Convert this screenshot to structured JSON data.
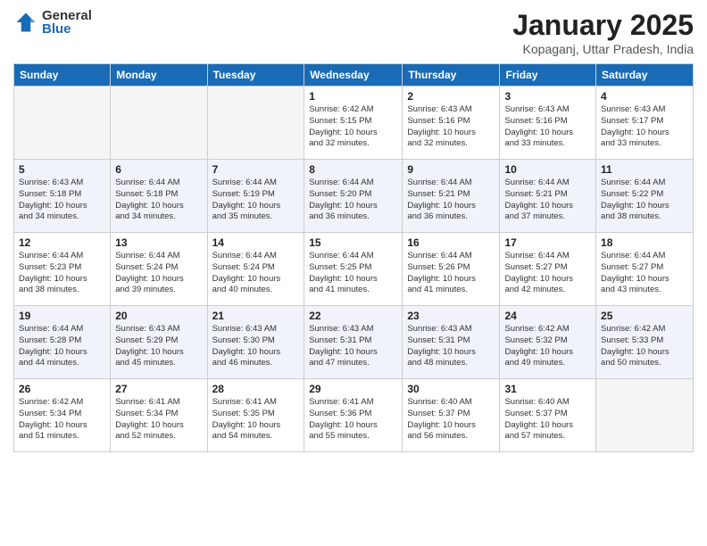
{
  "logo": {
    "general": "General",
    "blue": "Blue"
  },
  "title": {
    "month": "January 2025",
    "location": "Kopaganj, Uttar Pradesh, India"
  },
  "weekdays": [
    "Sunday",
    "Monday",
    "Tuesday",
    "Wednesday",
    "Thursday",
    "Friday",
    "Saturday"
  ],
  "weeks": [
    [
      {
        "day": "",
        "info": ""
      },
      {
        "day": "",
        "info": ""
      },
      {
        "day": "",
        "info": ""
      },
      {
        "day": "1",
        "info": "Sunrise: 6:42 AM\nSunset: 5:15 PM\nDaylight: 10 hours\nand 32 minutes."
      },
      {
        "day": "2",
        "info": "Sunrise: 6:43 AM\nSunset: 5:16 PM\nDaylight: 10 hours\nand 32 minutes."
      },
      {
        "day": "3",
        "info": "Sunrise: 6:43 AM\nSunset: 5:16 PM\nDaylight: 10 hours\nand 33 minutes."
      },
      {
        "day": "4",
        "info": "Sunrise: 6:43 AM\nSunset: 5:17 PM\nDaylight: 10 hours\nand 33 minutes."
      }
    ],
    [
      {
        "day": "5",
        "info": "Sunrise: 6:43 AM\nSunset: 5:18 PM\nDaylight: 10 hours\nand 34 minutes."
      },
      {
        "day": "6",
        "info": "Sunrise: 6:44 AM\nSunset: 5:18 PM\nDaylight: 10 hours\nand 34 minutes."
      },
      {
        "day": "7",
        "info": "Sunrise: 6:44 AM\nSunset: 5:19 PM\nDaylight: 10 hours\nand 35 minutes."
      },
      {
        "day": "8",
        "info": "Sunrise: 6:44 AM\nSunset: 5:20 PM\nDaylight: 10 hours\nand 36 minutes."
      },
      {
        "day": "9",
        "info": "Sunrise: 6:44 AM\nSunset: 5:21 PM\nDaylight: 10 hours\nand 36 minutes."
      },
      {
        "day": "10",
        "info": "Sunrise: 6:44 AM\nSunset: 5:21 PM\nDaylight: 10 hours\nand 37 minutes."
      },
      {
        "day": "11",
        "info": "Sunrise: 6:44 AM\nSunset: 5:22 PM\nDaylight: 10 hours\nand 38 minutes."
      }
    ],
    [
      {
        "day": "12",
        "info": "Sunrise: 6:44 AM\nSunset: 5:23 PM\nDaylight: 10 hours\nand 38 minutes."
      },
      {
        "day": "13",
        "info": "Sunrise: 6:44 AM\nSunset: 5:24 PM\nDaylight: 10 hours\nand 39 minutes."
      },
      {
        "day": "14",
        "info": "Sunrise: 6:44 AM\nSunset: 5:24 PM\nDaylight: 10 hours\nand 40 minutes."
      },
      {
        "day": "15",
        "info": "Sunrise: 6:44 AM\nSunset: 5:25 PM\nDaylight: 10 hours\nand 41 minutes."
      },
      {
        "day": "16",
        "info": "Sunrise: 6:44 AM\nSunset: 5:26 PM\nDaylight: 10 hours\nand 41 minutes."
      },
      {
        "day": "17",
        "info": "Sunrise: 6:44 AM\nSunset: 5:27 PM\nDaylight: 10 hours\nand 42 minutes."
      },
      {
        "day": "18",
        "info": "Sunrise: 6:44 AM\nSunset: 5:27 PM\nDaylight: 10 hours\nand 43 minutes."
      }
    ],
    [
      {
        "day": "19",
        "info": "Sunrise: 6:44 AM\nSunset: 5:28 PM\nDaylight: 10 hours\nand 44 minutes."
      },
      {
        "day": "20",
        "info": "Sunrise: 6:43 AM\nSunset: 5:29 PM\nDaylight: 10 hours\nand 45 minutes."
      },
      {
        "day": "21",
        "info": "Sunrise: 6:43 AM\nSunset: 5:30 PM\nDaylight: 10 hours\nand 46 minutes."
      },
      {
        "day": "22",
        "info": "Sunrise: 6:43 AM\nSunset: 5:31 PM\nDaylight: 10 hours\nand 47 minutes."
      },
      {
        "day": "23",
        "info": "Sunrise: 6:43 AM\nSunset: 5:31 PM\nDaylight: 10 hours\nand 48 minutes."
      },
      {
        "day": "24",
        "info": "Sunrise: 6:42 AM\nSunset: 5:32 PM\nDaylight: 10 hours\nand 49 minutes."
      },
      {
        "day": "25",
        "info": "Sunrise: 6:42 AM\nSunset: 5:33 PM\nDaylight: 10 hours\nand 50 minutes."
      }
    ],
    [
      {
        "day": "26",
        "info": "Sunrise: 6:42 AM\nSunset: 5:34 PM\nDaylight: 10 hours\nand 51 minutes."
      },
      {
        "day": "27",
        "info": "Sunrise: 6:41 AM\nSunset: 5:34 PM\nDaylight: 10 hours\nand 52 minutes."
      },
      {
        "day": "28",
        "info": "Sunrise: 6:41 AM\nSunset: 5:35 PM\nDaylight: 10 hours\nand 54 minutes."
      },
      {
        "day": "29",
        "info": "Sunrise: 6:41 AM\nSunset: 5:36 PM\nDaylight: 10 hours\nand 55 minutes."
      },
      {
        "day": "30",
        "info": "Sunrise: 6:40 AM\nSunset: 5:37 PM\nDaylight: 10 hours\nand 56 minutes."
      },
      {
        "day": "31",
        "info": "Sunrise: 6:40 AM\nSunset: 5:37 PM\nDaylight: 10 hours\nand 57 minutes."
      },
      {
        "day": "",
        "info": ""
      }
    ]
  ]
}
